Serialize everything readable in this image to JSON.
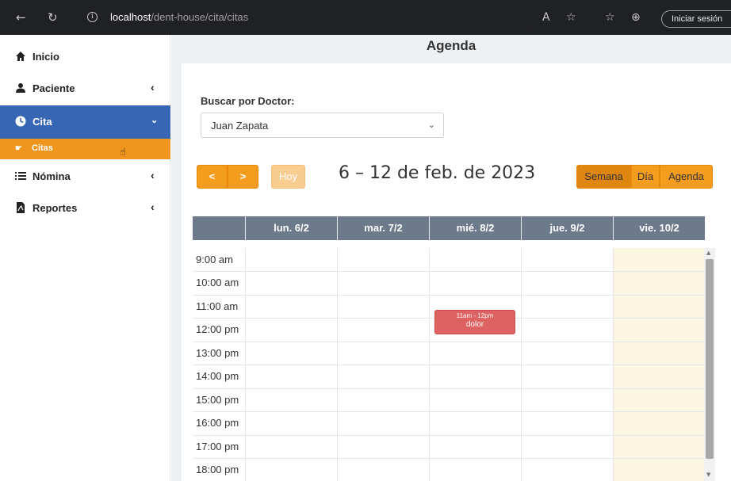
{
  "browser": {
    "url_host": "localhost",
    "url_path": "/dent-house/cita/citas",
    "signin_label": "Iniciar sesión"
  },
  "sidebar": {
    "items": [
      {
        "label": "Inicio",
        "icon": "home-icon"
      },
      {
        "label": "Paciente",
        "icon": "user-icon"
      },
      {
        "label": "Cita",
        "icon": "clock-icon"
      },
      {
        "label": "Nómina",
        "icon": "list-icon"
      },
      {
        "label": "Reportes",
        "icon": "pdf-file-icon"
      }
    ],
    "sub_item": {
      "label": "Citas",
      "icon": "hand-pointer-icon"
    }
  },
  "page": {
    "title": "Agenda",
    "search_label": "Buscar por Doctor:",
    "doctor_selected": "Juan Zapata"
  },
  "calendar": {
    "range_title": "6 – 12 de feb. de 2023",
    "buttons": {
      "prev": "<",
      "next": ">",
      "today": "Hoy",
      "week": "Semana",
      "day": "Día",
      "agenda": "Agenda"
    },
    "days": [
      "lun. 6/2",
      "mar. 7/2",
      "mié. 8/2",
      "jue. 9/2",
      "vie. 10/2"
    ],
    "times": [
      "9:00 am",
      "10:00 am",
      "11:00 am",
      "12:00 pm",
      "13:00 pm",
      "14:00 pm",
      "15:00 pm",
      "16:00 pm",
      "17:00 pm",
      "18:00 pm"
    ],
    "event": {
      "time": "11am - 12pm",
      "title": "dolor",
      "day": "mié. 8/2",
      "color": "#df6262"
    },
    "accent_color": "#f39c1e",
    "active_nav_color": "#3767b4"
  }
}
